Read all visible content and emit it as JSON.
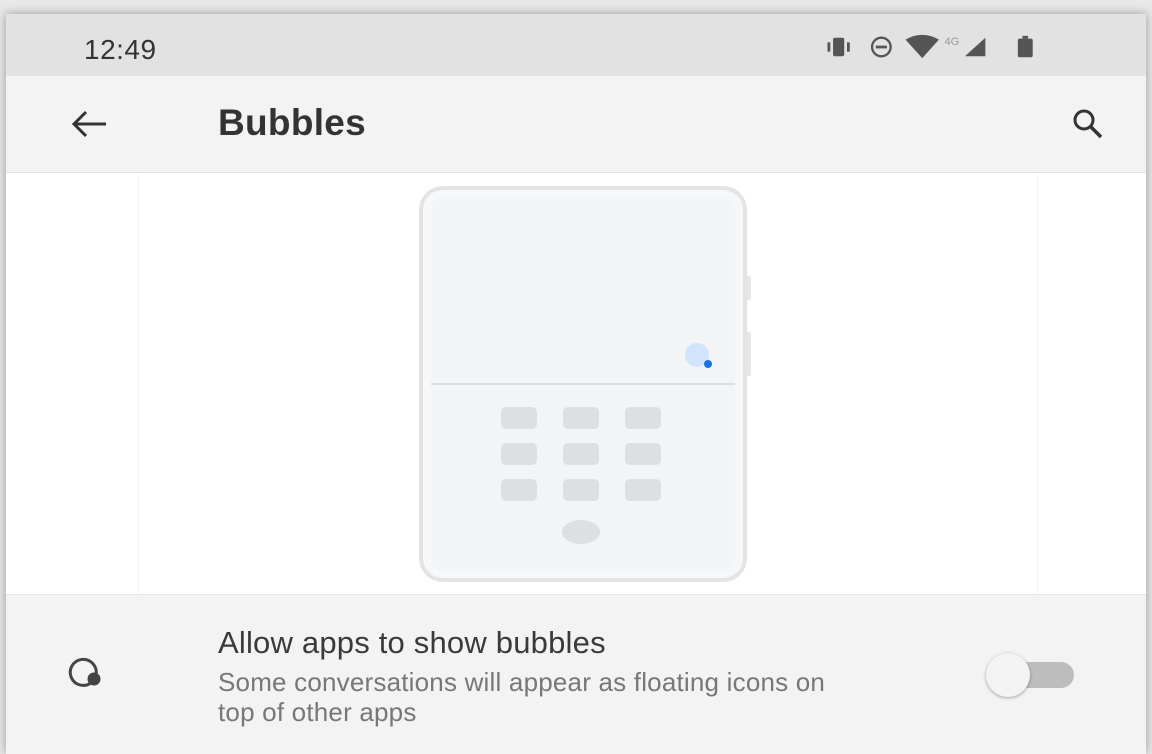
{
  "status_bar": {
    "time": "12:49",
    "network_label": "4G",
    "icons": [
      "vibrate-icon",
      "do-not-disturb-icon",
      "wifi-icon",
      "cell-signal-icon",
      "battery-icon"
    ]
  },
  "app_bar": {
    "title": "Bubbles",
    "back_icon": "arrow-back-icon",
    "search_icon": "search-icon"
  },
  "setting": {
    "title": "Allow apps to show bubbles",
    "summary": "Some conversations will appear as floating icons on top of other apps",
    "icon": "bubble-icon",
    "toggle_on": false
  },
  "colors": {
    "accent": "#1a73e8",
    "bubble": "#d2e3fc",
    "surface": "#f3f3f3",
    "status_bar": "#e2e2e2"
  }
}
